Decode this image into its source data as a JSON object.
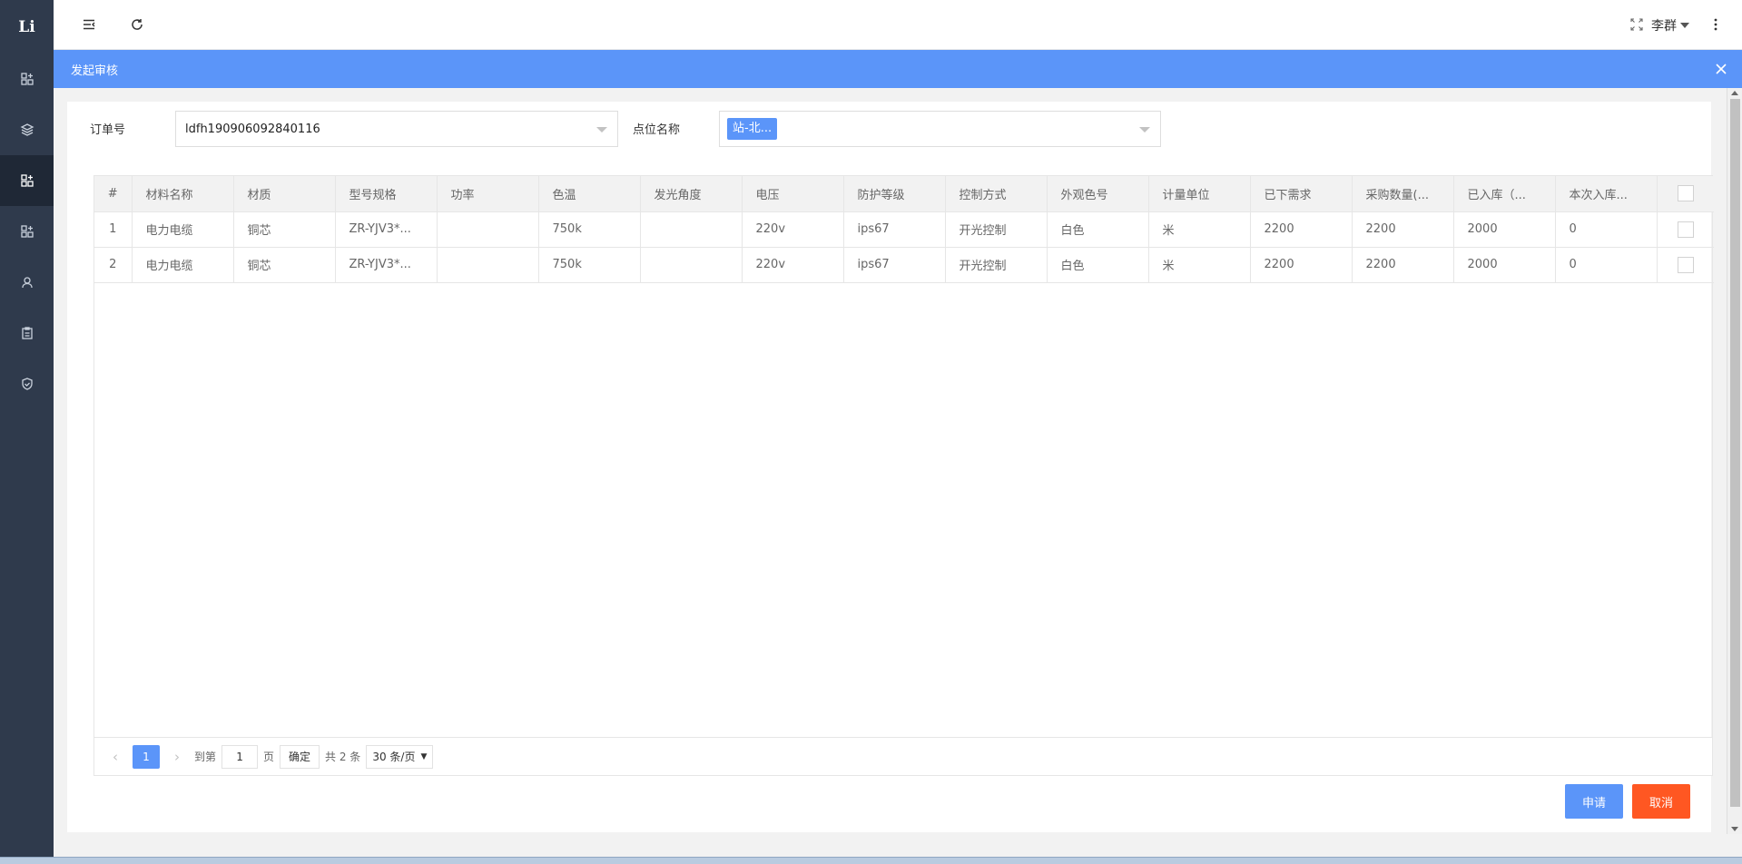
{
  "app": {
    "logo_text": "Li",
    "user_name": "李群"
  },
  "modal": {
    "title": "发起审核"
  },
  "form": {
    "order_label": "订单号",
    "order_value": "ldfh190906092840116",
    "site_label": "点位名称",
    "site_tag": "站-北..."
  },
  "table": {
    "headers": [
      "#",
      "材料名称",
      "材质",
      "型号规格",
      "功率",
      "色温",
      "发光角度",
      "电压",
      "防护等级",
      "控制方式",
      "外观色号",
      "计量单位",
      "已下需求",
      "采购数量(...",
      "已入库（...",
      "本次入库..."
    ],
    "rows": [
      [
        "1",
        "电力电缆",
        "铜芯",
        "ZR-YJV3*...",
        "",
        "750k",
        "",
        "220v",
        "ips67",
        "开光控制",
        "白色",
        "米",
        "2200",
        "2200",
        "2000",
        "0"
      ],
      [
        "2",
        "电力电缆",
        "铜芯",
        "ZR-YJV3*...",
        "",
        "750k",
        "",
        "220v",
        "ips67",
        "开光控制",
        "白色",
        "米",
        "2200",
        "2200",
        "2000",
        "0"
      ]
    ]
  },
  "pager": {
    "current_page": "1",
    "goto_label": "到第",
    "goto_value": "1",
    "page_unit": "页",
    "confirm_label": "确定",
    "total_text": "共 2 条",
    "page_size": "30 条/页"
  },
  "actions": {
    "apply_label": "申请",
    "cancel_label": "取消"
  },
  "colors": {
    "primary": "#5b95f9",
    "danger": "#ff5722",
    "sidebar": "#2f3a4c"
  },
  "icons": {
    "sidebar": [
      "apps-icon",
      "layers-icon",
      "apps-add-icon",
      "apps-add-icon",
      "user-icon",
      "clipboard-icon",
      "shield-icon"
    ],
    "header": [
      "menu-toggle-icon",
      "refresh-icon",
      "fullscreen-icon",
      "more-vertical-icon"
    ]
  }
}
